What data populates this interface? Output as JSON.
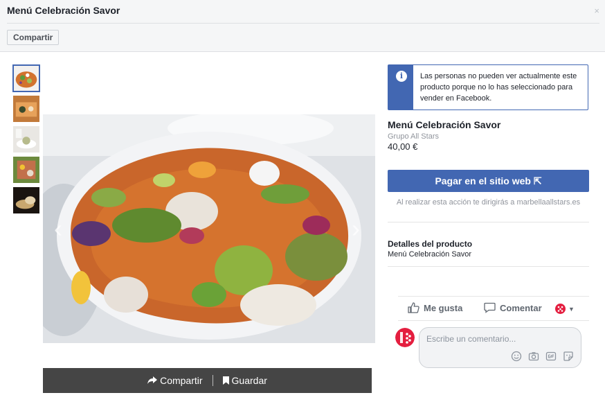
{
  "header": {
    "title": "Menú Celebración Savor",
    "close_glyph": "×",
    "share_label": "Compartir"
  },
  "photo": {
    "prev_glyph": "‹",
    "next_glyph": "›",
    "actions": {
      "share_label": "Compartir",
      "save_label": "Guardar"
    }
  },
  "thumbnails": [
    {
      "name": "thumbnail-1",
      "active": true
    },
    {
      "name": "thumbnail-2",
      "active": false
    },
    {
      "name": "thumbnail-3",
      "active": false
    },
    {
      "name": "thumbnail-4",
      "active": false
    },
    {
      "name": "thumbnail-5",
      "active": false
    }
  ],
  "notice": {
    "icon": "info-icon",
    "icon_glyph": "i",
    "text": "Las personas no pueden ver actualmente este producto porque no lo has seleccionado para vender en Facebook."
  },
  "product": {
    "title": "Menú Celebración Savor",
    "seller": "Grupo All Stars",
    "price": "40,00 €",
    "pay_button": "Pagar en el sitio web ⇱",
    "redirect_note": "Al realizar esta acción te dirigirás a marbellaallstars.es",
    "details_heading": "Detalles del producto",
    "details_value": "Menú Celebración Savor"
  },
  "social": {
    "like_label": "Me gusta",
    "comment_label": "Comentar",
    "comment_placeholder": "Escribe un comentario..."
  },
  "colors": {
    "brand": "#4267b2",
    "header_bg": "#f5f6f7",
    "photo_bar_bg": "#454545"
  }
}
